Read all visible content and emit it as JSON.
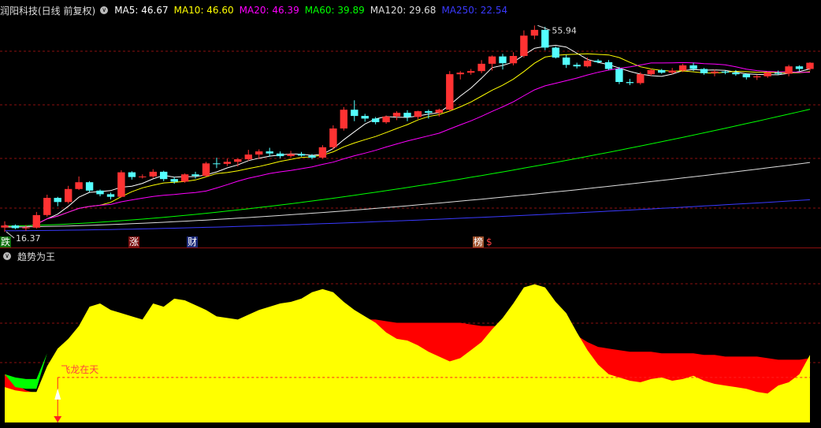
{
  "main_panel": {
    "stock_title": "润阳科技(日线 前复权)",
    "ma_items": [
      {
        "label": "MA5: 46.67",
        "color": "#ffffff"
      },
      {
        "label": "MA10: 46.60",
        "color": "#ffff00"
      },
      {
        "label": "MA20: 46.39",
        "color": "#ff00ff"
      },
      {
        "label": "MA60: 39.89",
        "color": "#00ff00"
      },
      {
        "label": "MA120: 29.68",
        "color": "#dddddd"
      },
      {
        "label": "MA250: 22.54",
        "color": "#3a3aff"
      }
    ],
    "high_label": "55.94",
    "low_label": "16.37",
    "event_tags": [
      {
        "text": "跌",
        "bg": "#0a6e0a",
        "color": "#ffffff"
      },
      {
        "text": "涨",
        "bg": "#7a0f0f",
        "color": "#ffffff"
      },
      {
        "text": "财",
        "bg": "#1d2b7a",
        "color": "#ffffff"
      },
      {
        "text": "榜",
        "bg": "#a0522d",
        "color": "#ffffff"
      },
      {
        "text": "$",
        "bg": "#000000",
        "color": "#ff4040"
      }
    ]
  },
  "indicator_panel": {
    "title": "趋势为王",
    "signal_label": "飞龙在天"
  },
  "colors": {
    "up": "#ff3232",
    "down": "#54ffff",
    "yellow_area": "#ffff00",
    "red_area": "#ff0000",
    "green_area": "#00ff00",
    "grid": "#8c1010"
  },
  "chart_data": {
    "type": "candlestick",
    "candles": [
      [
        17.2,
        18.4,
        16.4,
        17.6
      ],
      [
        17.6,
        17.8,
        16.9,
        17.1
      ],
      [
        17.1,
        17.7,
        16.6,
        17.2
      ],
      [
        17.2,
        20.2,
        17.0,
        19.6
      ],
      [
        19.6,
        23.5,
        19.3,
        22.9
      ],
      [
        22.9,
        23.1,
        21.3,
        22.1
      ],
      [
        22.1,
        25.2,
        21.8,
        24.6
      ],
      [
        24.6,
        27.0,
        24.4,
        25.9
      ],
      [
        25.9,
        26.1,
        24.0,
        24.3
      ],
      [
        24.3,
        24.5,
        23.2,
        23.6
      ],
      [
        23.6,
        23.9,
        22.6,
        23.1
      ],
      [
        23.1,
        28.2,
        23.0,
        27.8
      ],
      [
        27.8,
        28.0,
        26.4,
        26.9
      ],
      [
        26.9,
        27.4,
        26.6,
        27.0
      ],
      [
        27.0,
        28.4,
        26.7,
        27.9
      ],
      [
        27.9,
        28.1,
        26.1,
        26.5
      ],
      [
        26.5,
        26.9,
        25.6,
        26.0
      ],
      [
        26.0,
        27.6,
        25.8,
        27.4
      ],
      [
        27.4,
        27.9,
        26.6,
        27.1
      ],
      [
        27.1,
        29.8,
        26.9,
        29.5
      ],
      [
        29.5,
        30.6,
        28.6,
        29.4
      ],
      [
        29.4,
        30.4,
        29.0,
        29.8
      ],
      [
        29.8,
        30.5,
        28.9,
        30.3
      ],
      [
        30.3,
        32.1,
        30.0,
        31.2
      ],
      [
        31.2,
        32.2,
        30.3,
        31.8
      ],
      [
        31.8,
        32.5,
        30.8,
        31.4
      ],
      [
        31.4,
        31.8,
        30.5,
        30.9
      ],
      [
        30.9,
        31.9,
        30.6,
        31.3
      ],
      [
        31.3,
        31.7,
        30.8,
        31.0
      ],
      [
        31.0,
        31.3,
        30.3,
        30.6
      ],
      [
        30.6,
        33.0,
        30.4,
        32.6
      ],
      [
        32.6,
        36.8,
        32.2,
        36.2
      ],
      [
        36.2,
        40.3,
        35.8,
        39.8
      ],
      [
        39.8,
        41.6,
        37.6,
        38.6
      ],
      [
        38.6,
        39.0,
        37.5,
        38.1
      ],
      [
        38.1,
        38.4,
        37.0,
        37.4
      ],
      [
        37.4,
        38.7,
        37.1,
        38.5
      ],
      [
        38.5,
        39.5,
        37.8,
        39.2
      ],
      [
        39.2,
        39.7,
        37.6,
        38.4
      ],
      [
        38.4,
        39.6,
        38.0,
        39.5
      ],
      [
        39.5,
        39.8,
        38.1,
        39.2
      ],
      [
        39.2,
        40.0,
        38.5,
        39.8
      ],
      [
        39.8,
        47.2,
        39.5,
        46.6
      ],
      [
        46.6,
        47.2,
        45.6,
        46.9
      ],
      [
        46.9,
        47.6,
        46.5,
        47.2
      ],
      [
        47.2,
        49.3,
        46.8,
        48.6
      ],
      [
        48.6,
        50.2,
        47.3,
        50.0
      ],
      [
        50.0,
        50.5,
        47.5,
        48.7
      ],
      [
        48.7,
        50.8,
        48.3,
        50.1
      ],
      [
        50.1,
        55.0,
        49.8,
        54.0
      ],
      [
        54.0,
        55.94,
        53.3,
        55.1
      ],
      [
        55.1,
        55.7,
        51.2,
        51.7
      ],
      [
        51.7,
        51.9,
        49.6,
        49.8
      ],
      [
        49.8,
        50.3,
        47.8,
        48.4
      ],
      [
        48.4,
        48.8,
        47.7,
        48.1
      ],
      [
        48.1,
        49.8,
        47.9,
        49.2
      ],
      [
        49.2,
        49.5,
        48.7,
        48.9
      ],
      [
        48.9,
        49.3,
        47.4,
        47.6
      ],
      [
        47.6,
        48.0,
        44.7,
        45.1
      ],
      [
        45.1,
        45.7,
        44.5,
        44.9
      ],
      [
        44.9,
        47.0,
        44.6,
        46.6
      ],
      [
        46.6,
        47.7,
        46.3,
        47.4
      ],
      [
        47.4,
        47.6,
        46.7,
        46.9
      ],
      [
        46.9,
        47.8,
        46.6,
        47.3
      ],
      [
        47.3,
        48.6,
        47.0,
        48.3
      ],
      [
        48.3,
        48.8,
        47.2,
        47.6
      ],
      [
        47.6,
        47.8,
        46.5,
        46.8
      ],
      [
        46.8,
        47.5,
        46.2,
        47.1
      ],
      [
        47.1,
        47.3,
        46.6,
        46.9
      ],
      [
        46.9,
        47.4,
        46.3,
        46.6
      ],
      [
        46.6,
        46.8,
        45.6,
        46.0
      ],
      [
        46.0,
        46.5,
        45.5,
        46.2
      ],
      [
        46.2,
        47.1,
        45.9,
        46.9
      ],
      [
        46.9,
        47.3,
        46.5,
        46.7
      ],
      [
        46.7,
        48.4,
        46.2,
        48.1
      ],
      [
        48.1,
        48.3,
        47.2,
        47.6
      ],
      [
        47.6,
        48.9,
        47.3,
        48.8
      ]
    ],
    "y_range": [
      15.5,
      57.5
    ],
    "indicator": {
      "y_range": [
        0,
        100
      ],
      "yellow": [
        22,
        20,
        19,
        19,
        35,
        46,
        52,
        60,
        72,
        74,
        70,
        68,
        66,
        64,
        74,
        72,
        77,
        76,
        73,
        70,
        66,
        65,
        64,
        67,
        70,
        72,
        74,
        75,
        77,
        81,
        83,
        81,
        75,
        70,
        66,
        62,
        56,
        52,
        51,
        48,
        44,
        41,
        38,
        40,
        45,
        50,
        58,
        65,
        74,
        84,
        86,
        84,
        75,
        68,
        56,
        45,
        36,
        30,
        28,
        26,
        25,
        27,
        28,
        26,
        27,
        29,
        26,
        24,
        23,
        22,
        21,
        19,
        18,
        23,
        25,
        30,
        42
      ],
      "red": [
        30,
        24,
        20,
        18,
        33,
        46,
        50,
        58,
        67,
        69,
        67,
        64,
        63,
        63,
        68,
        69,
        70,
        70,
        69,
        66,
        64,
        63,
        63,
        63,
        65,
        66,
        67,
        68,
        68,
        68,
        68,
        67,
        66,
        65,
        64,
        64,
        63,
        62,
        62,
        62,
        62,
        62,
        62,
        62,
        61,
        60,
        60,
        60,
        60,
        60,
        60,
        60,
        60,
        58,
        54,
        50,
        47,
        46,
        45,
        44,
        44,
        44,
        43,
        43,
        43,
        43,
        42,
        42,
        41,
        41,
        41,
        41,
        40,
        39,
        39,
        39,
        40
      ],
      "baseline": 28,
      "signal_bar_index": 5
    }
  }
}
